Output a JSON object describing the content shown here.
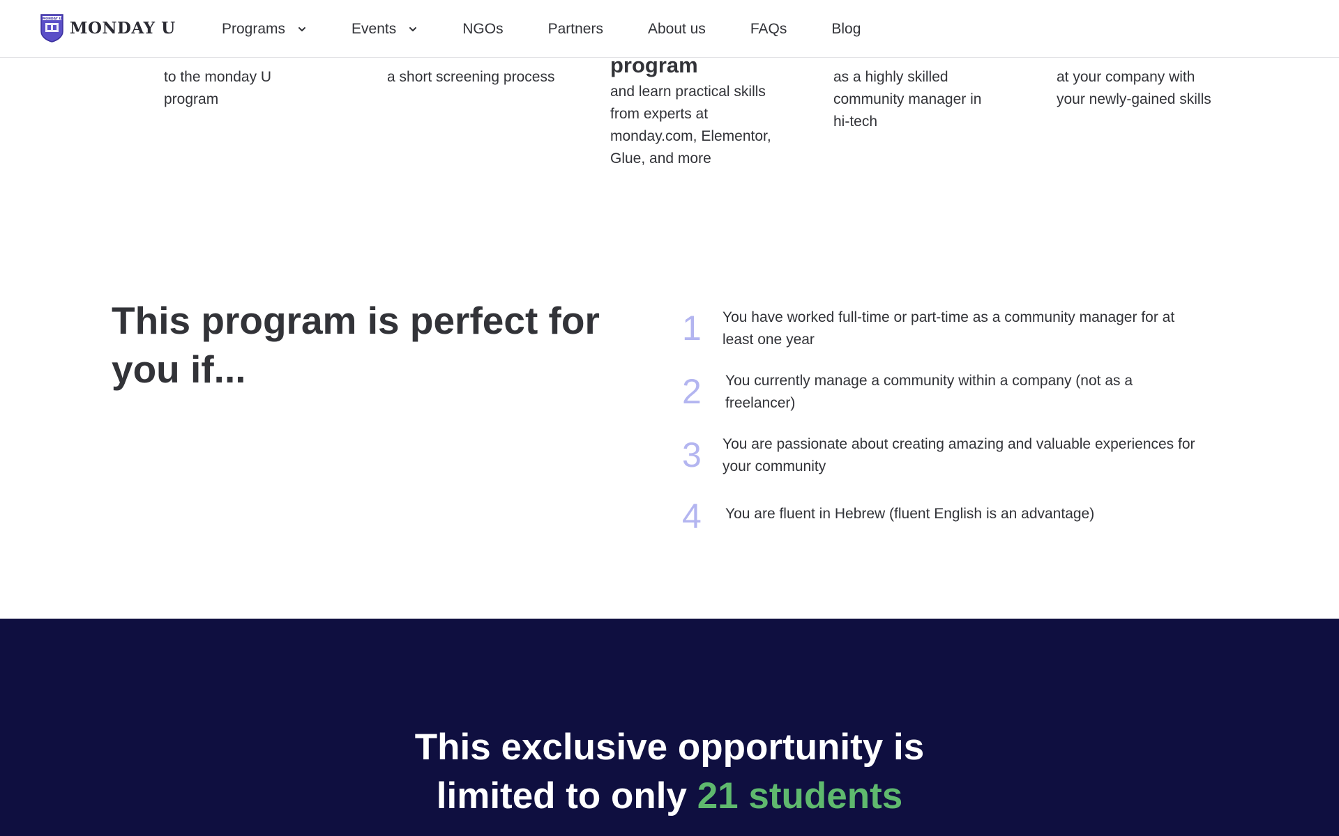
{
  "header": {
    "logo_text": "MONDAY U",
    "logo_shield_text": "MONDAY U",
    "nav": [
      {
        "label": "Programs",
        "has_dropdown": true
      },
      {
        "label": "Events",
        "has_dropdown": true
      },
      {
        "label": "NGOs",
        "has_dropdown": false
      },
      {
        "label": "Partners",
        "has_dropdown": false
      },
      {
        "label": "About us",
        "has_dropdown": false
      },
      {
        "label": "FAQs",
        "has_dropdown": false
      },
      {
        "label": "Blog",
        "has_dropdown": false
      }
    ]
  },
  "steps": [
    {
      "lines": [
        "to the monday U",
        "program"
      ]
    },
    {
      "lines": [
        "a short screening process"
      ]
    },
    {
      "title": "program",
      "lines": [
        "and learn practical skills",
        "from experts at",
        "monday.com, Elementor,",
        "Glue, and more"
      ]
    },
    {
      "lines": [
        "as a highly skilled",
        "community manager in",
        "hi-tech"
      ]
    },
    {
      "lines": [
        "at your company with",
        "your newly-gained skills"
      ]
    }
  ],
  "perfect": {
    "title_line1": "This program is perfect for",
    "title_line2": "you if...",
    "requirements": [
      {
        "num": "1",
        "text_line1": "You have worked full-time or part-time as a community manager for at",
        "text_line2": "least one year"
      },
      {
        "num": "2",
        "text_line1": "You currently manage a community within a company (not as a",
        "text_line2": "freelancer)"
      },
      {
        "num": "3",
        "text_line1": "You are passionate about creating amazing and valuable experiences for",
        "text_line2": "your community"
      },
      {
        "num": "4",
        "text_line1": "You are fluent in Hebrew (fluent English is an advantage)",
        "text_line2": ""
      }
    ]
  },
  "banner": {
    "line1": "This exclusive opportunity is",
    "line2_prefix": "limited to only ",
    "line2_highlight": "21 students"
  },
  "colors": {
    "accent_number": "#b3b5f0",
    "banner_bg": "#0f0f40",
    "highlight_green": "#5fb96e",
    "logo_purple": "#5b4fc7"
  }
}
